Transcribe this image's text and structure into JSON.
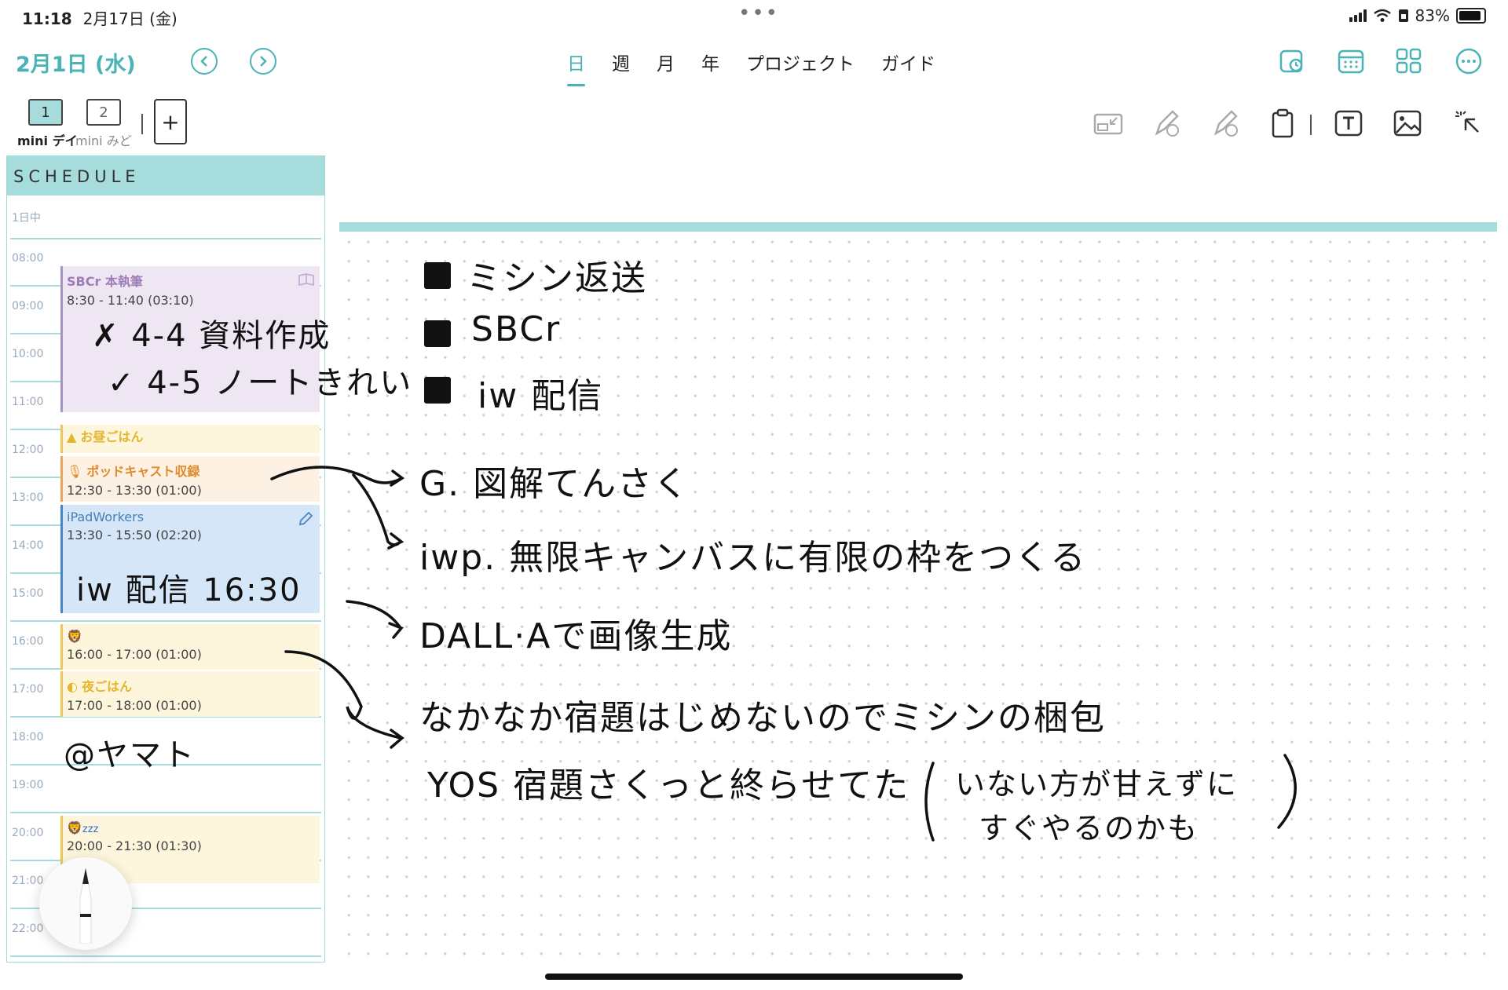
{
  "status": {
    "time": "11:18",
    "date": "2月17日 (金)",
    "battery": "83%"
  },
  "header": {
    "date_title": "2月1日 (水)",
    "tabs": [
      {
        "label": "日"
      },
      {
        "label": "週"
      },
      {
        "label": "月"
      },
      {
        "label": "年"
      },
      {
        "label": "プロジェクト"
      },
      {
        "label": "ガイド"
      }
    ],
    "active_tab": "日"
  },
  "pages": [
    {
      "num": "1",
      "label": "mini デイ"
    },
    {
      "num": "2",
      "label": "mini みど"
    }
  ],
  "schedule": {
    "title": "SCHEDULE",
    "allday": "1日中",
    "hours": [
      "08:00",
      "09:00",
      "10:00",
      "11:00",
      "12:00",
      "13:00",
      "14:00",
      "15:00",
      "16:00",
      "17:00",
      "18:00",
      "19:00",
      "20:00",
      "21:00",
      "22:00"
    ],
    "events": [
      {
        "title": "SBCr 本執筆",
        "time": "8:30 - 11:40 (03:10)"
      },
      {
        "title": "お昼ごはん",
        "time": ""
      },
      {
        "title": "ポッドキャスト収録",
        "time": "12:30 - 13:30 (01:00)"
      },
      {
        "title": "iPadWorkers",
        "time": "13:30 - 15:50 (02:20)"
      },
      {
        "title": "",
        "time": "16:00 - 17:00 (01:00)"
      },
      {
        "title": "夜ごはん",
        "time": "17:00 - 18:00 (01:00)"
      },
      {
        "title": "zzz",
        "time": "20:00 - 21:30 (01:30)"
      }
    ]
  },
  "handwriting": {
    "sched_notes": [
      "4-4 資料作成",
      "4-5 ノートきれい",
      "iw 配信 16:30",
      "@ヤマト"
    ],
    "todos": [
      "ミシン返送",
      "SBCr",
      "iw 配信"
    ],
    "notes": [
      "G. 図解てんさく",
      "iwp. 無限キャンバスに有限の枠をつくる",
      "DALL·Aで画像生成",
      "なかなか宿題はじめないのでミシンの梱包",
      "YOS 宿題さくっと終らせてた",
      "いない方が甘えずに",
      "すぐやるのかも"
    ]
  },
  "colors": {
    "accent": "#4ab3b5",
    "sched_header": "#a7dcdc",
    "purple_event": "#efe6f4",
    "yellow_event": "#fdf6dd",
    "blue_event": "#d4e6f8"
  }
}
